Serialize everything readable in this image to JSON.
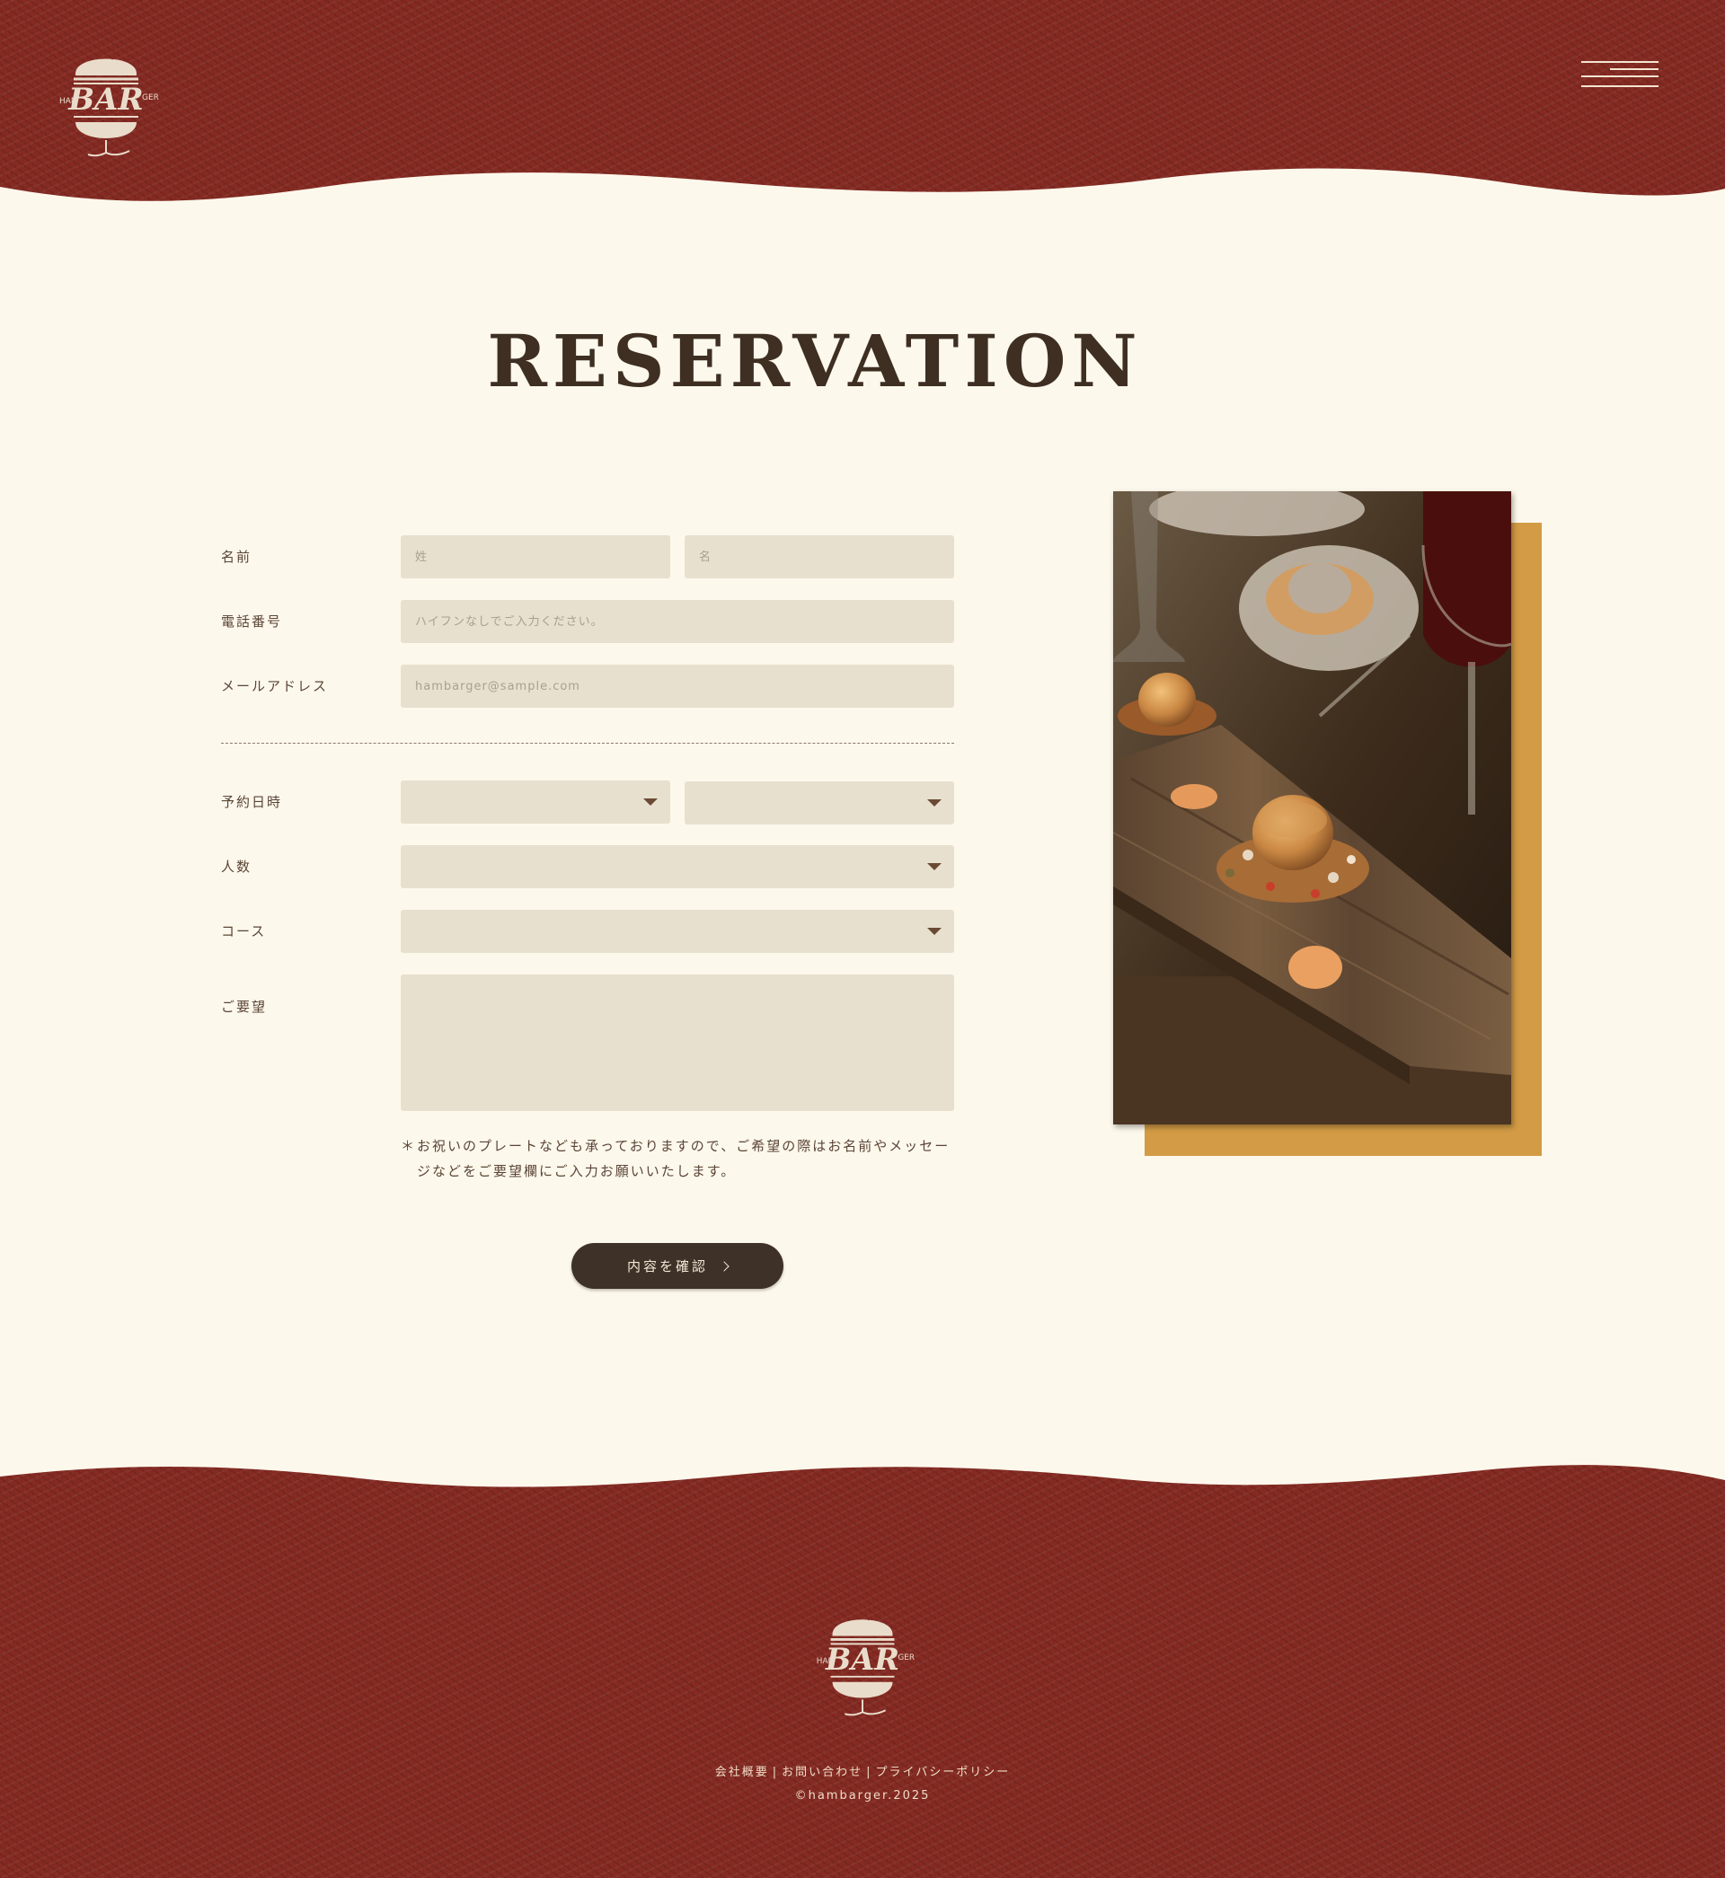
{
  "header": {
    "logo": {
      "left": "HAM",
      "main": "BAR",
      "right": "GER"
    },
    "menu_icon": "hamburger-menu-icon"
  },
  "page": {
    "title": "RESERVATION"
  },
  "form": {
    "name": {
      "label": "名前",
      "last_placeholder": "姓",
      "first_placeholder": "名"
    },
    "phone": {
      "label": "電話番号",
      "placeholder": "ハイフンなしでご入力ください。"
    },
    "email": {
      "label": "メールアドレス",
      "placeholder": "hambarger@sample.com"
    },
    "datetime": {
      "label": "予約日時",
      "date_value": "",
      "time_value": ""
    },
    "guests": {
      "label": "人数",
      "value": ""
    },
    "course": {
      "label": "コース",
      "value": ""
    },
    "requests": {
      "label": "ご要望",
      "value": ""
    },
    "note_mark": "＊",
    "note": "お祝いのプレートなども承っておりますので、ご希望の際はお名前やメッセージなどをご要望欄にご入力お願いいたします。",
    "submit_label": "内容を確認"
  },
  "footer": {
    "logo": {
      "left": "HAM",
      "main": "BAR",
      "right": "GER"
    },
    "links": [
      "会社概要",
      "お問い合わせ",
      "プライバシーポリシー"
    ],
    "separator": "|",
    "copyright": "©hambarger.2025"
  },
  "colors": {
    "brand_red": "#862b23",
    "cream": "#fdf8ec",
    "field": "#e8e0cf",
    "dark": "#3e3127",
    "accent_gold": "#d39b45"
  }
}
